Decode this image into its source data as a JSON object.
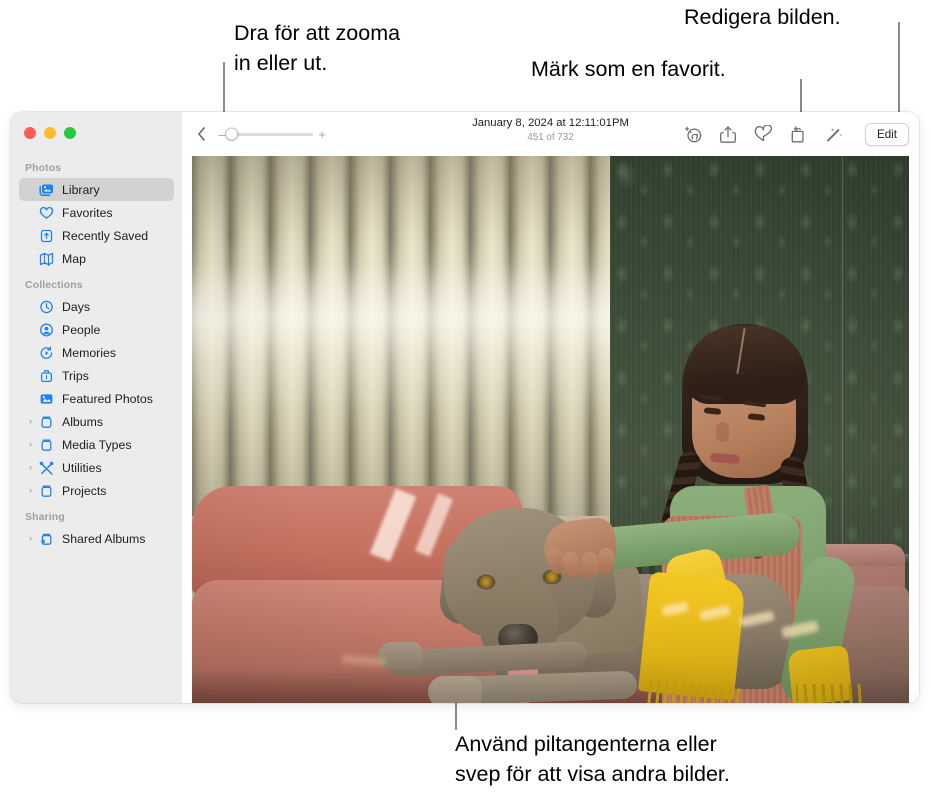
{
  "callouts": [
    {
      "id": "zoom",
      "text": "Dra för att zooma\nin eller ut."
    },
    {
      "id": "fav",
      "text": "Märk som en favorit."
    },
    {
      "id": "edit",
      "text": "Redigera bilden."
    },
    {
      "id": "arrows",
      "text": "Använd piltangenterna eller\nsvep för att visa andra bilder."
    }
  ],
  "window": {
    "traffic_lights": {
      "close_color": "#ff5f57",
      "minimize_color": "#febc2e",
      "zoom_color": "#28c840"
    }
  },
  "sidebar": {
    "sections": [
      {
        "title": "Photos",
        "items": [
          {
            "label": "Library",
            "icon": "photos-library-icon",
            "selected": true,
            "disclosure": false
          },
          {
            "label": "Favorites",
            "icon": "heart-icon",
            "selected": false,
            "disclosure": false
          },
          {
            "label": "Recently Saved",
            "icon": "tray-arrow-up-icon",
            "selected": false,
            "disclosure": false
          },
          {
            "label": "Map",
            "icon": "map-icon",
            "selected": false,
            "disclosure": false
          }
        ]
      },
      {
        "title": "Collections",
        "items": [
          {
            "label": "Days",
            "icon": "clock-icon",
            "selected": false,
            "disclosure": false
          },
          {
            "label": "People",
            "icon": "person-circle-icon",
            "selected": false,
            "disclosure": false
          },
          {
            "label": "Memories",
            "icon": "memories-play-icon",
            "selected": false,
            "disclosure": false
          },
          {
            "label": "Trips",
            "icon": "suitcase-icon",
            "selected": false,
            "disclosure": false
          },
          {
            "label": "Featured Photos",
            "icon": "photo-icon",
            "selected": false,
            "disclosure": false
          },
          {
            "label": "Albums",
            "icon": "album-box-icon",
            "selected": false,
            "disclosure": true
          },
          {
            "label": "Media Types",
            "icon": "album-box-icon",
            "selected": false,
            "disclosure": true
          },
          {
            "label": "Utilities",
            "icon": "tools-icon",
            "selected": false,
            "disclosure": true
          },
          {
            "label": "Projects",
            "icon": "album-box-icon",
            "selected": false,
            "disclosure": true
          }
        ]
      },
      {
        "title": "Sharing",
        "items": [
          {
            "label": "Shared Albums",
            "icon": "shared-album-icon",
            "selected": false,
            "disclosure": true
          }
        ]
      }
    ],
    "disclosure_glyph": "›",
    "accent_color": "#1b84f2",
    "selected_row_color": "#d2d2d2"
  },
  "toolbar": {
    "back_icon": "chevron-left-icon",
    "zoom": {
      "minus_label": "–",
      "plus_label": "+",
      "value_percent": 0
    },
    "title": "January 8, 2024 at 12:11:01PM",
    "subtitle": "451 of 732",
    "actions": [
      {
        "name": "identify-subject-icon",
        "label": "Visual Look Up"
      },
      {
        "name": "share-icon",
        "label": "Share"
      },
      {
        "name": "heart-icon",
        "label": "Favorite"
      },
      {
        "name": "rotate-icon",
        "label": "Rotate"
      },
      {
        "name": "magic-wand-icon",
        "label": "Auto Enhance"
      }
    ],
    "edit_label": "Edit"
  },
  "photo": {
    "description": "Girl with braids petting a Weimaraner dog on a salmon sofa",
    "background_left": "vertical blinds",
    "background_right": "dark green damask wallpaper"
  }
}
